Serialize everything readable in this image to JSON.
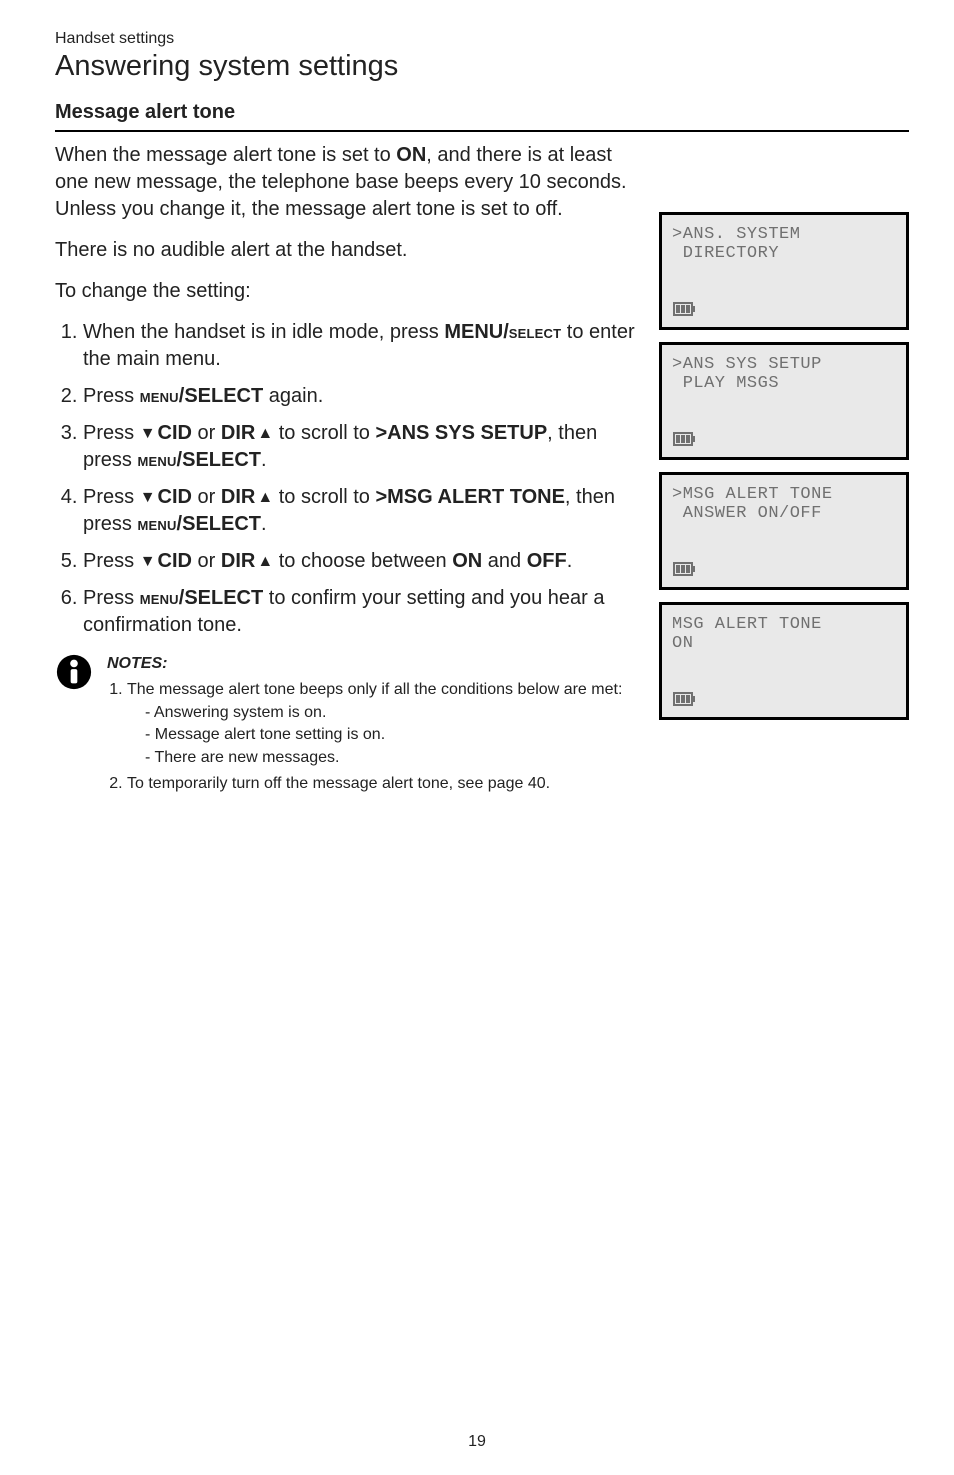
{
  "breadcrumb": "Handset settings",
  "page_title": "Answering system settings",
  "subheading": "Message alert tone",
  "intro_text_before_on": "When the message alert tone is set to ",
  "on_literal": "ON",
  "intro_text_after_on": ", and there is at least one new message, the telephone base beeps every 10 seconds. Unless you change it, the message alert tone is set to off.",
  "no_audible": "There is no audible alert at the handset.",
  "to_change": "To change the setting:",
  "steps": {
    "s1_a": "When the handset is in idle mode, press ",
    "s1_b": "MENU/",
    "s1_c": "select",
    "s1_d": " to enter the main menu.",
    "s2_a": "Press ",
    "s2_b": "menu",
    "s2_c": "/SELECT",
    "s2_d": " again.",
    "s3_a": "Press ",
    "s3_cid": "CID",
    "s3_or": " or ",
    "s3_dir": "DIR",
    "s3_scroll": " to scroll to ",
    "s3_target": ">ANS SYS SETUP",
    "s3_then": ", then press ",
    "s3_menu": "menu",
    "s3_sel": "/SELECT",
    "s3_end": ".",
    "s4_target": ">MSG ALERT TONE",
    "s5_a": "Press ",
    "s5_choose": " to choose between ",
    "s5_on": "ON",
    "s5_and": " and ",
    "s5_off": "OFF",
    "s5_end": ".",
    "s6_a": "Press ",
    "s6_menu": "menu",
    "s6_sel": "/SELECT",
    "s6_conf": " to confirm your setting and you hear a confirmation tone."
  },
  "lcd": {
    "screen1_l1": ">ANS. SYSTEM",
    "screen1_l2": " DIRECTORY",
    "screen2_l1": ">ANS SYS SETUP",
    "screen2_l2": " PLAY MSGS",
    "screen3_l1": ">MSG ALERT TONE",
    "screen3_l2": " ANSWER ON/OFF",
    "screen4_l1": "MSG ALERT TONE",
    "screen4_l2": "ON"
  },
  "notes": {
    "heading": "NOTES:",
    "n1": "The message alert tone beeps only if all the conditions below are met:",
    "c1": "Answering system is on.",
    "c2": "Message alert tone setting is on.",
    "c3": "There are new messages.",
    "n2": "To temporarily turn off the message alert tone, see page 40."
  },
  "page_number": "19"
}
